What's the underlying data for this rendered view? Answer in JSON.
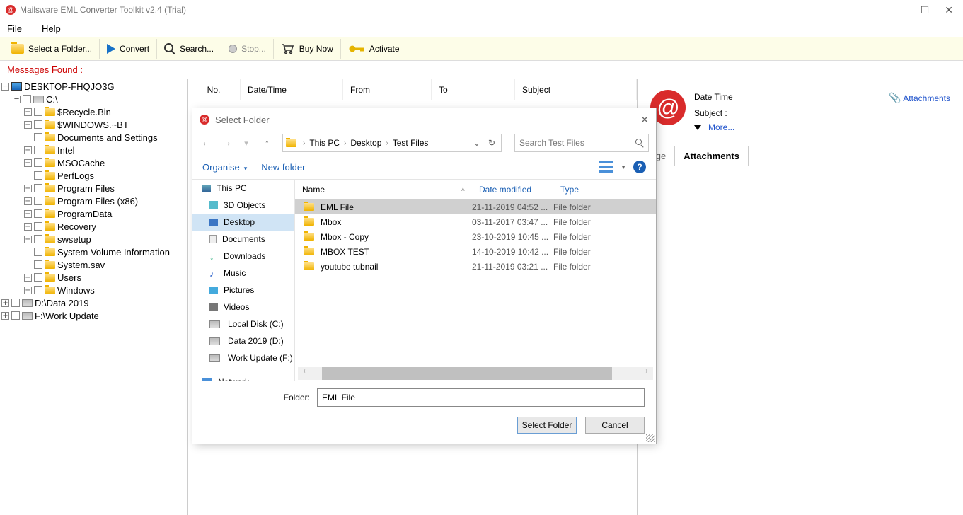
{
  "title": "Mailsware EML Converter Toolkit v2.4 (Trial)",
  "menu": {
    "file": "File",
    "help": "Help"
  },
  "toolbar": {
    "select": "Select a Folder...",
    "convert": "Convert",
    "search": "Search...",
    "stop": "Stop...",
    "buy": "Buy Now",
    "activate": "Activate"
  },
  "msgFound": "Messages Found :",
  "treeRoot": "DESKTOP-FHQJO3G",
  "drives": {
    "c": "C:\\",
    "d": "D:\\Data 2019",
    "f": "F:\\Work Update"
  },
  "cFolders": [
    "$Recycle.Bin",
    "$WINDOWS.~BT",
    "Documents and Settings",
    "Intel",
    "MSOCache",
    "PerfLogs",
    "Program Files",
    "Program Files (x86)",
    "ProgramData",
    "Recovery",
    "swsetup",
    "System Volume Information",
    "System.sav",
    "Users",
    "Windows"
  ],
  "mailCols": {
    "no": "No.",
    "dt": "Date/Time",
    "from": "From",
    "to": "To",
    "subj": "Subject"
  },
  "preview": {
    "dt": "Date Time",
    "subj": "Subject :",
    "more": "More...",
    "attach": "Attachments",
    "tabMsg": "sage",
    "tabAtt": "Attachments"
  },
  "dialog": {
    "title": "Select Folder",
    "crumb": {
      "pc": "This PC",
      "desktop": "Desktop",
      "tests": "Test Files"
    },
    "searchPh": "Search Test Files",
    "organise": "Organise",
    "newFolder": "New folder",
    "cols": {
      "name": "Name",
      "dm": "Date modified",
      "type": "Type"
    },
    "side": {
      "thispc": "This PC",
      "threed": "3D Objects",
      "desktop": "Desktop",
      "docs": "Documents",
      "dl": "Downloads",
      "music": "Music",
      "pics": "Pictures",
      "vids": "Videos",
      "ldc": "Local Disk (C:)",
      "d19": "Data 2019 (D:)",
      "wu": "Work Update (F:)",
      "net": "Network"
    },
    "rows": [
      {
        "n": "EML File",
        "d": "21-11-2019 04:52 ...",
        "t": "File folder"
      },
      {
        "n": "Mbox",
        "d": "03-11-2017 03:47 ...",
        "t": "File folder"
      },
      {
        "n": "Mbox - Copy",
        "d": "23-10-2019 10:45 ...",
        "t": "File folder"
      },
      {
        "n": "MBOX TEST",
        "d": "14-10-2019 10:42 ...",
        "t": "File folder"
      },
      {
        "n": "youtube tubnail",
        "d": "21-11-2019 03:21 ...",
        "t": "File folder"
      }
    ],
    "folderLbl": "Folder:",
    "folderVal": "EML File",
    "btnSelect": "Select Folder",
    "btnCancel": "Cancel"
  }
}
